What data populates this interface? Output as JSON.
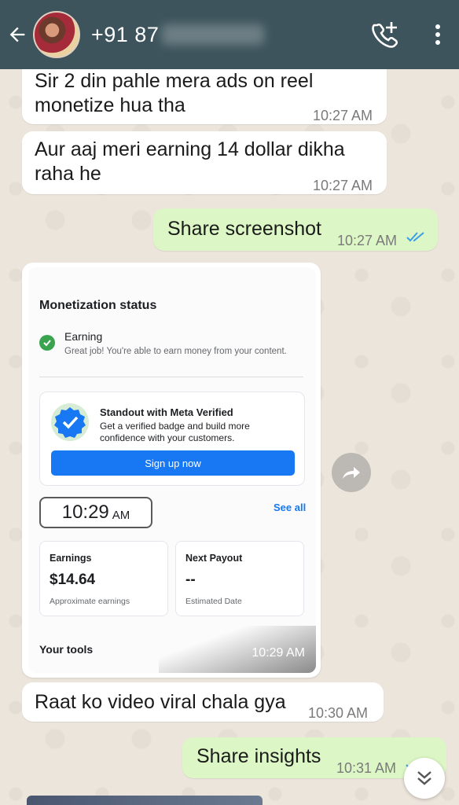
{
  "header": {
    "contact_name": "+91 87",
    "icons": {
      "back": "arrow-left-icon",
      "call": "add-call-icon",
      "menu": "more-vert-icon"
    },
    "background": "#3d545c"
  },
  "messages": [
    {
      "direction": "in",
      "text_line1": "Sir 2 din pahle mera ads on reel",
      "text_line2": "monetize hua tha",
      "time": "10:27 AM"
    },
    {
      "direction": "in",
      "text_line1": "Aur aaj meri earning 14 dollar dikha",
      "text_line2": "raha he",
      "time": "10:27 AM"
    },
    {
      "direction": "out",
      "text": "Share screenshot",
      "time": "10:27 AM",
      "read": true
    },
    {
      "direction": "in",
      "text": "Raat ko video viral chala gya",
      "time": "10:30 AM"
    },
    {
      "direction": "out",
      "text": "Share insights",
      "time": "10:31 AM",
      "read": true
    }
  ],
  "image_message": {
    "time": "10:29 AM",
    "screenshot": {
      "title": "Monetization status",
      "status_label": "Earning",
      "status_desc": "Great job! You're able to earn money from your content.",
      "verified_title": "Standout with Meta Verified",
      "verified_desc": "Get a verified badge and build more confidence with your customers.",
      "signup_label": "Sign up now",
      "clock_time": "10:29",
      "clock_ampm": "AM",
      "see_all": "See all",
      "earnings_label": "Earnings",
      "earnings_value": "$14.64",
      "earnings_sub": "Approximate earnings",
      "payout_label": "Next Payout",
      "payout_value": "--",
      "payout_sub": "Estimated Date",
      "tools_label": "Your tools"
    }
  },
  "colors": {
    "outgoing_bubble": "#dcf7c5",
    "incoming_bubble": "#ffffff",
    "read_ticks": "#3b9ee8",
    "meta_blue": "#1877f2"
  }
}
